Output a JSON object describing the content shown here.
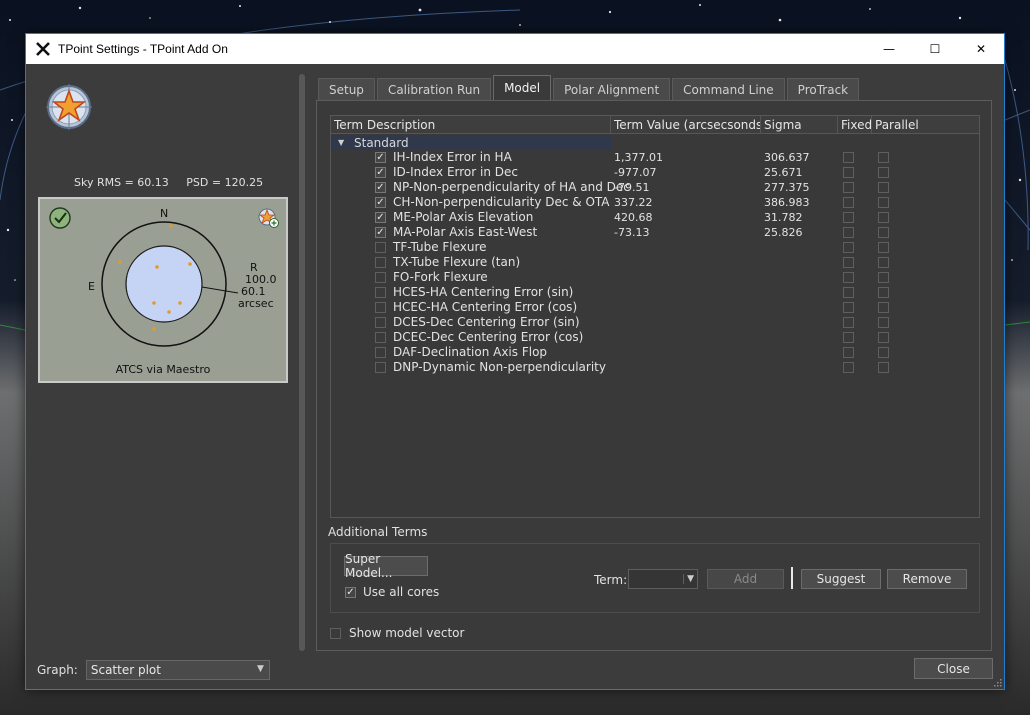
{
  "window": {
    "title": "TPoint Settings - TPoint Add On",
    "minimize": "—",
    "maximize": "☐",
    "close": "✕"
  },
  "left_panel": {
    "sky_rms_label": "Sky RMS =",
    "sky_rms_value": "60.13",
    "psd_label": "PSD =",
    "psd_value": "120.25",
    "plot": {
      "compass_n": "N",
      "compass_e": "E",
      "label_r": "R",
      "ring_outer_value": "100.0",
      "ring_inner_value": "60.1",
      "unit": "arcsec",
      "caption": "ATCS via Maestro",
      "point_color": "#e39a2c"
    },
    "graph_label": "Graph:",
    "graph_value": "Scatter plot"
  },
  "tabs": [
    {
      "label": "Setup",
      "active": false
    },
    {
      "label": "Calibration Run",
      "active": false
    },
    {
      "label": "Model",
      "active": true
    },
    {
      "label": "Polar Alignment",
      "active": false
    },
    {
      "label": "Command Line",
      "active": false
    },
    {
      "label": "ProTrack",
      "active": false
    }
  ],
  "term_table": {
    "headers": {
      "description": "Term Description",
      "value": "Term Value (arcsecsonds)",
      "sigma": "Sigma",
      "fixed": "Fixed",
      "parallel": "Parallel"
    },
    "group": "Standard",
    "rows": [
      {
        "checked": true,
        "name": "IH-Index Error in HA",
        "value": "1,377.01",
        "sigma": "306.637"
      },
      {
        "checked": true,
        "name": "ID-Index Error in Dec",
        "value": "-977.07",
        "sigma": "25.671"
      },
      {
        "checked": true,
        "name": "NP-Non-perpendicularity of HA and Dec",
        "value": "-79.51",
        "sigma": "277.375"
      },
      {
        "checked": true,
        "name": "CH-Non-perpendicularity Dec & OTA",
        "value": "337.22",
        "sigma": "386.983"
      },
      {
        "checked": true,
        "name": "ME-Polar Axis Elevation",
        "value": "420.68",
        "sigma": "31.782"
      },
      {
        "checked": true,
        "name": "MA-Polar Axis East-West",
        "value": "-73.13",
        "sigma": "25.826"
      },
      {
        "checked": false,
        "name": "TF-Tube Flexure",
        "value": "",
        "sigma": ""
      },
      {
        "checked": false,
        "name": "TX-Tube Flexure (tan)",
        "value": "",
        "sigma": ""
      },
      {
        "checked": false,
        "name": "FO-Fork Flexure",
        "value": "",
        "sigma": ""
      },
      {
        "checked": false,
        "name": "HCES-HA Centering Error (sin)",
        "value": "",
        "sigma": ""
      },
      {
        "checked": false,
        "name": "HCEC-HA Centering Error (cos)",
        "value": "",
        "sigma": ""
      },
      {
        "checked": false,
        "name": "DCES-Dec Centering Error (sin)",
        "value": "",
        "sigma": ""
      },
      {
        "checked": false,
        "name": "DCEC-Dec Centering Error (cos)",
        "value": "",
        "sigma": ""
      },
      {
        "checked": false,
        "name": "DAF-Declination Axis Flop",
        "value": "",
        "sigma": ""
      },
      {
        "checked": false,
        "name": "DNP-Dynamic Non-perpendicularity",
        "value": "",
        "sigma": ""
      }
    ]
  },
  "additional_terms": {
    "label": "Additional Terms",
    "super_model": "Super Model...",
    "use_all_cores": "Use all cores",
    "use_all_cores_checked": true,
    "term_label": "Term:",
    "term_value": "",
    "add": "Add",
    "suggest": "Suggest",
    "remove": "Remove"
  },
  "show_model_vector": "Show model vector",
  "show_model_vector_checked": false,
  "close_button": "Close",
  "colors": {
    "accent": "#1d7fd1",
    "window_bg": "#3c3c3c",
    "selection": "#30384c"
  }
}
